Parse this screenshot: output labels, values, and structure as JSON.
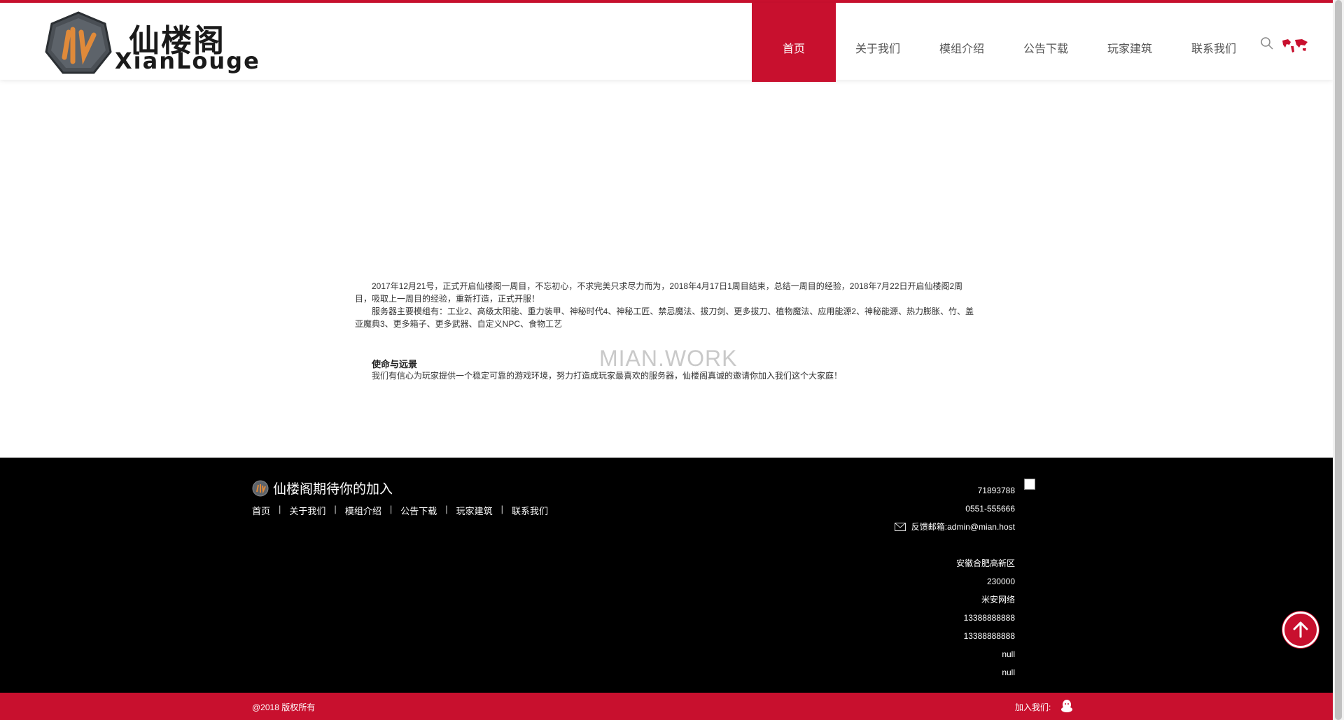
{
  "header": {
    "logo_cn": "仙楼阁",
    "logo_en": "XianLouge",
    "nav": [
      {
        "label": "首页",
        "active": true
      },
      {
        "label": "关于我们",
        "active": false
      },
      {
        "label": "模组介绍",
        "active": false
      },
      {
        "label": "公告下载",
        "active": false
      },
      {
        "label": "玩家建筑",
        "active": false
      },
      {
        "label": "联系我们",
        "active": false
      }
    ],
    "icons": [
      "search-icon",
      "globe-icon"
    ]
  },
  "main": {
    "paragraph_1": "2017年12月21号，正式开启仙楼阁一周目，不忘初心，不求完美只求尽力而为，2018年4月17日1周目结束，总结一周目的经验，2018年7月22日开启仙楼阁2周目，吸取上一周目的经验，重新打造，正式开服！",
    "paragraph_2": "服务器主要模组有：工业2、高级太阳能、重力装甲、神秘时代4、神秘工匠、禁忌魔法、拔刀剑、更多拔刀、植物魔法、应用能源2、神秘能源、热力膨胀、竹、盖亚魔典3、更多箱子、更多武器、自定义NPC、食物工艺",
    "mission_title": "使命与远景",
    "mission_text": "我们有信心为玩家提供一个稳定可靠的游戏环境，努力打造成玩家最喜欢的服务器，仙楼阁真诚的邀请你加入我们这个大家庭！",
    "watermark": "MIAN.WORK"
  },
  "footer": {
    "brand": "仙楼阁期待你的加入",
    "links": [
      "首页",
      "关于我们",
      "模组介绍",
      "公告下载",
      "玩家建筑",
      "联系我们"
    ],
    "contact": {
      "qq": "71893788",
      "phone": "0551-555666",
      "email": "反馈邮箱:admin@mian.host",
      "address": "安徽合肥高新区",
      "postcode": "230000",
      "company": "米安网络",
      "mobile_1": "13388888888",
      "mobile_2": "13388888888",
      "null_1": "null",
      "null_2": "null"
    },
    "copyright": "@2018 版权所有",
    "join_label": "加入我们:"
  },
  "colors": {
    "brand_red": "#c8102e",
    "footer_bg": "#000000"
  }
}
